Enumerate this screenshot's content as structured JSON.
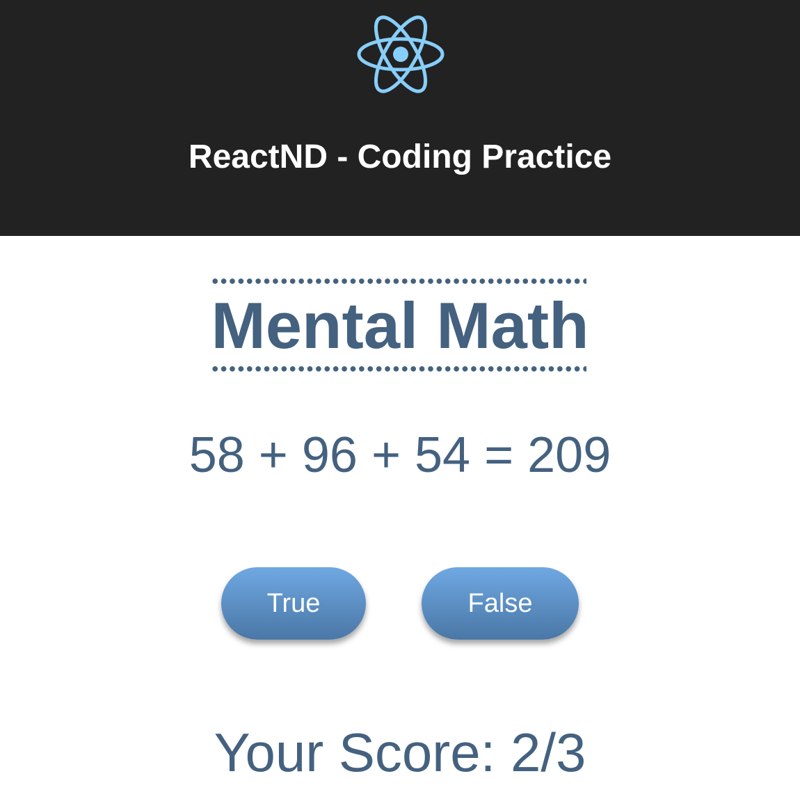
{
  "header": {
    "title": "ReactND - Coding Practice",
    "logo_icon": "react-atom-icon",
    "logo_color": "#87cefa"
  },
  "game": {
    "title": "Mental Math",
    "equation": "58 + 96 + 54 = 209",
    "buttons": {
      "true_label": "True",
      "false_label": "False"
    },
    "score_text": "Your Score: 2/3"
  },
  "colors": {
    "header_bg": "#222222",
    "text_accent": "#44617f",
    "button_gradient_top": "#6fa8e2",
    "button_gradient_bottom": "#4a77a6"
  }
}
